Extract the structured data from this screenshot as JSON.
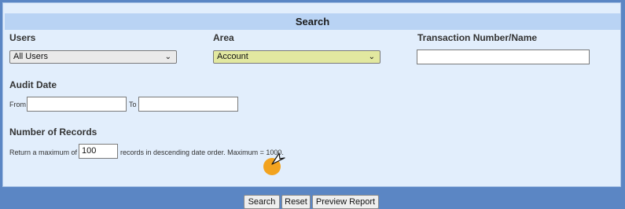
{
  "search_panel": {
    "title": "Search",
    "users": {
      "label": "Users",
      "selected": "All Users"
    },
    "area": {
      "label": "Area",
      "selected": "Account"
    },
    "transaction": {
      "label": "Transaction Number/Name",
      "value": ""
    },
    "audit_date": {
      "label": "Audit Date",
      "from_label": "From",
      "to_label": "To",
      "from_value": "",
      "to_value": ""
    },
    "records": {
      "label": "Number of Records",
      "prefix": "Return a maximum of",
      "value": "100",
      "suffix": "records in descending date order. Maximum = 1000."
    },
    "buttons": {
      "search": "Search",
      "reset": "Reset",
      "preview": "Preview Report"
    }
  },
  "colors": {
    "page_border": "#5b86c4",
    "panel_bg": "#e2eefc",
    "title_bg": "#b9d3f4",
    "area_select_bg": "#e2e8a0",
    "users_select_bg": "#eaeaea"
  },
  "cursor": {
    "icon": "pointer-cursor-icon",
    "highlight_color": "#f2a31f"
  }
}
